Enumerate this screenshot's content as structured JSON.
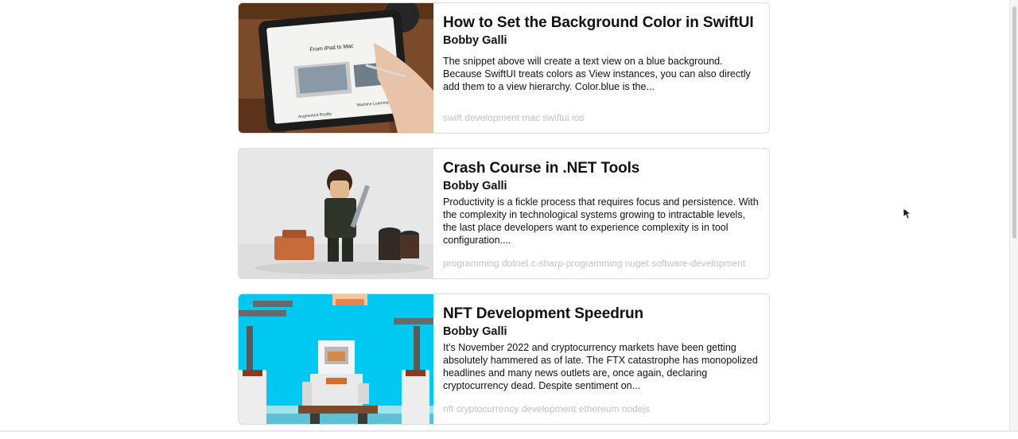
{
  "posts": [
    {
      "title": "How to Set the Background Color in SwiftUI",
      "author": "Bobby Galli",
      "excerpt": "The snippet above will create a text view on a blue background. Because SwiftUI treats colors as View instances, you can also directly add them to a view hierarchy. Color.blue is the...",
      "tags": "swift development mac swiftui ios",
      "image_caption": "From iPad to Mac",
      "image_label_left": "Augmented Reality",
      "image_label_right": "Machine Learning"
    },
    {
      "title": "Crash Course in .NET Tools",
      "author": "Bobby Galli",
      "excerpt": "Productivity is a fickle process that requires focus and persistence. With the complexity in technological systems growing to intractable levels, the last place developers want to experience complexity is in tool configuration....",
      "tags": "programming dotnet c-sharp-programming nuget software-development"
    },
    {
      "title": "NFT Development Speedrun",
      "author": "Bobby Galli",
      "excerpt": "It’s November 2022 and cryptocurrency markets have been getting absolutely hammered as of late. The FTX catastrophe has monopolized headlines and many news outlets are, once again, declaring cryptocurrency dead. Despite sentiment on...",
      "tags": "nft cryptocurrency development ethereum nodejs"
    }
  ]
}
